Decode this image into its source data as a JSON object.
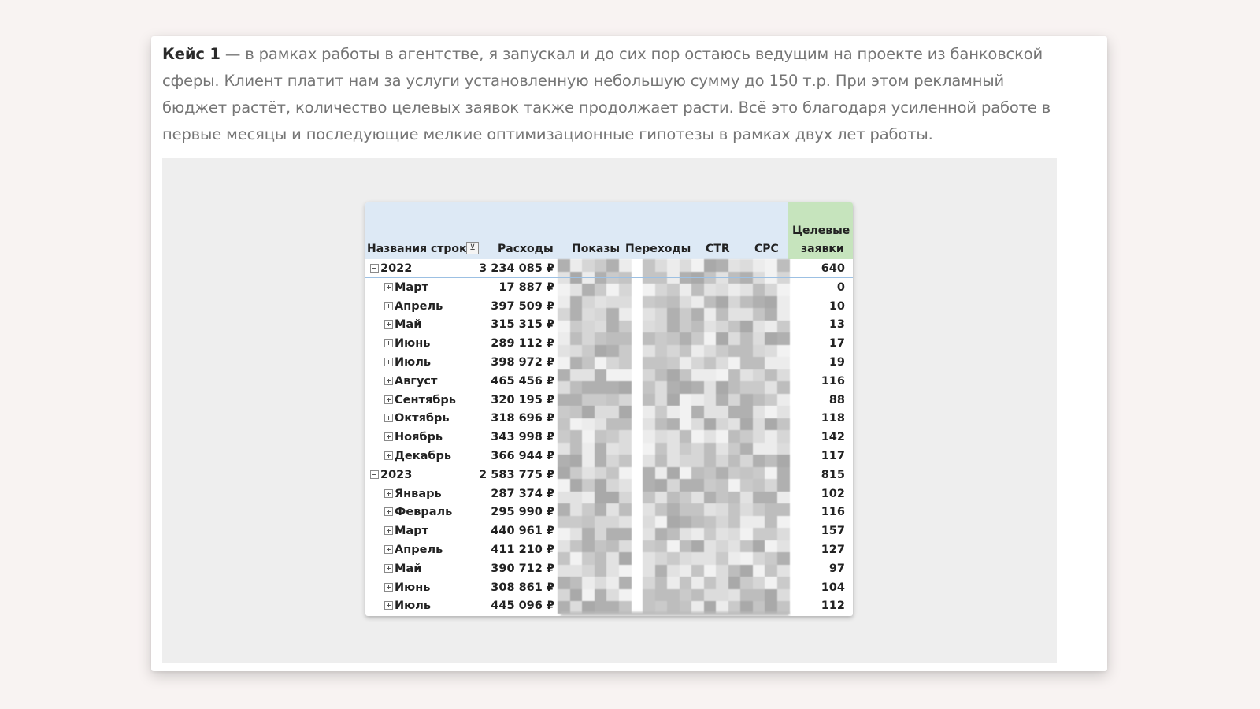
{
  "article": {
    "lead": "Кейс 1",
    "text": " — в рамках работы в агентстве, я запускал и до сих пор остаюсь ведущим на проекте из банковской сферы. Клиент платит нам за услуги установленную небольшую сумму до 150 т.р. При этом рекламный бюджет растёт, количество целевых заявок также продолжает расти. Всё это благодаря усиленной работе в первые месяцы и последующие мелкие оптимизационные гипотезы в рамках двух лет работы."
  },
  "table": {
    "headers": {
      "row_names": "Названия строк",
      "spend": "Расходы",
      "impressions": "Показы",
      "clicks": "Переходы",
      "ctr": "CTR",
      "cpc": "CPC",
      "leads_line1": "Целевые",
      "leads_line2": "заявки"
    },
    "filter_icon": "filter-icon",
    "rows": [
      {
        "type": "year",
        "label": "2022",
        "spend": "3 234 085 ₽",
        "leads": "640"
      },
      {
        "type": "month",
        "label": "Март",
        "spend": "17 887 ₽",
        "leads": "0"
      },
      {
        "type": "month",
        "label": "Апрель",
        "spend": "397 509 ₽",
        "leads": "10"
      },
      {
        "type": "month",
        "label": "Май",
        "spend": "315 315 ₽",
        "leads": "13"
      },
      {
        "type": "month",
        "label": "Июнь",
        "spend": "289 112 ₽",
        "leads": "17"
      },
      {
        "type": "month",
        "label": "Июль",
        "spend": "398 972 ₽",
        "leads": "19"
      },
      {
        "type": "month",
        "label": "Август",
        "spend": "465 456 ₽",
        "leads": "116"
      },
      {
        "type": "month",
        "label": "Сентябрь",
        "spend": "320 195 ₽",
        "leads": "88"
      },
      {
        "type": "month",
        "label": "Октябрь",
        "spend": "318 696 ₽",
        "leads": "118"
      },
      {
        "type": "month",
        "label": "Ноябрь",
        "spend": "343 998 ₽",
        "leads": "142"
      },
      {
        "type": "month",
        "label": "Декабрь",
        "spend": "366 944 ₽",
        "leads": "117"
      },
      {
        "type": "year",
        "label": "2023",
        "spend": "2 583 775 ₽",
        "leads": "815"
      },
      {
        "type": "month",
        "label": "Январь",
        "spend": "287 374 ₽",
        "leads": "102"
      },
      {
        "type": "month",
        "label": "Февраль",
        "spend": "295 990 ₽",
        "leads": "116"
      },
      {
        "type": "month",
        "label": "Март",
        "spend": "440 961 ₽",
        "leads": "157"
      },
      {
        "type": "month",
        "label": "Апрель",
        "spend": "411 210 ₽",
        "leads": "127"
      },
      {
        "type": "month",
        "label": "Май",
        "spend": "390 712 ₽",
        "leads": "97"
      },
      {
        "type": "month",
        "label": "Июнь",
        "spend": "308 861 ₽",
        "leads": "104"
      },
      {
        "type": "month",
        "label": "Июль",
        "spend": "445 096 ₽",
        "leads": "112"
      }
    ]
  },
  "colors": {
    "page_bg": "#f8f3f2",
    "header_blue": "#dde9f5",
    "header_green": "#c6e4bd",
    "body_text": "#757575",
    "lead_text": "#2b2b2b"
  }
}
